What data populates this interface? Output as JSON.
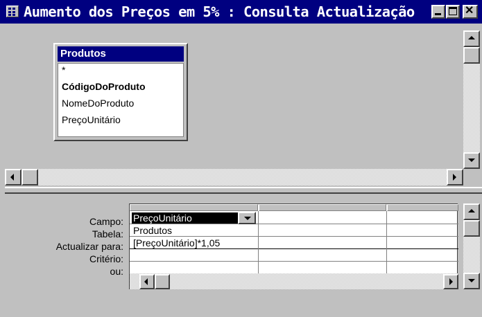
{
  "window": {
    "title": "Aumento dos Preços em 5% : Consulta Actualização"
  },
  "field_list": {
    "table_name": "Produtos",
    "fields": [
      "*",
      "CódigoDoProduto",
      "NomeDoProduto",
      "PreçoUnitário"
    ],
    "primary_key_field": "CódigoDoProduto"
  },
  "grid": {
    "row_labels": {
      "campo": "Campo:",
      "tabela": "Tabela:",
      "actualizar_para": "Actualizar para:",
      "criterio": "Critério:",
      "ou": "ou:"
    },
    "column1": {
      "campo": "PreçoUnitário",
      "tabela": "Produtos",
      "actualizar_para": "[PreçoUnitário]*1,05",
      "criterio": "",
      "ou": ""
    }
  },
  "colors": {
    "titlebar": "#000080",
    "face": "#c0c0c0",
    "selection": "#000000"
  }
}
